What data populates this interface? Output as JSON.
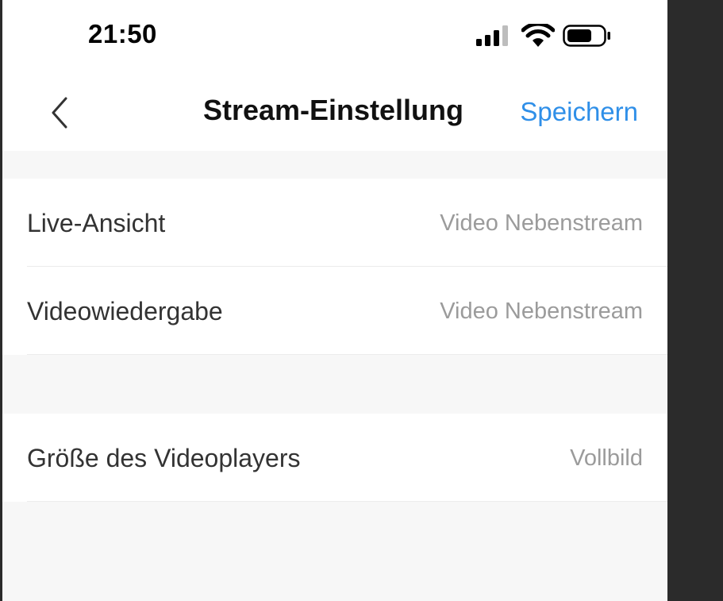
{
  "status_bar": {
    "time": "21:50"
  },
  "nav": {
    "title": "Stream-Einstellung",
    "save_label": "Speichern"
  },
  "groups": [
    {
      "rows": [
        {
          "label": "Live-Ansicht",
          "value": "Video Nebenstream"
        },
        {
          "label": "Videowiedergabe",
          "value": "Video Nebenstream"
        }
      ]
    },
    {
      "rows": [
        {
          "label": "Größe des Videoplayers",
          "value": "Vollbild"
        }
      ]
    }
  ],
  "colors": {
    "accent": "#2f8fe8",
    "background": "#f7f7f7",
    "value_text": "#9b9b9b"
  }
}
